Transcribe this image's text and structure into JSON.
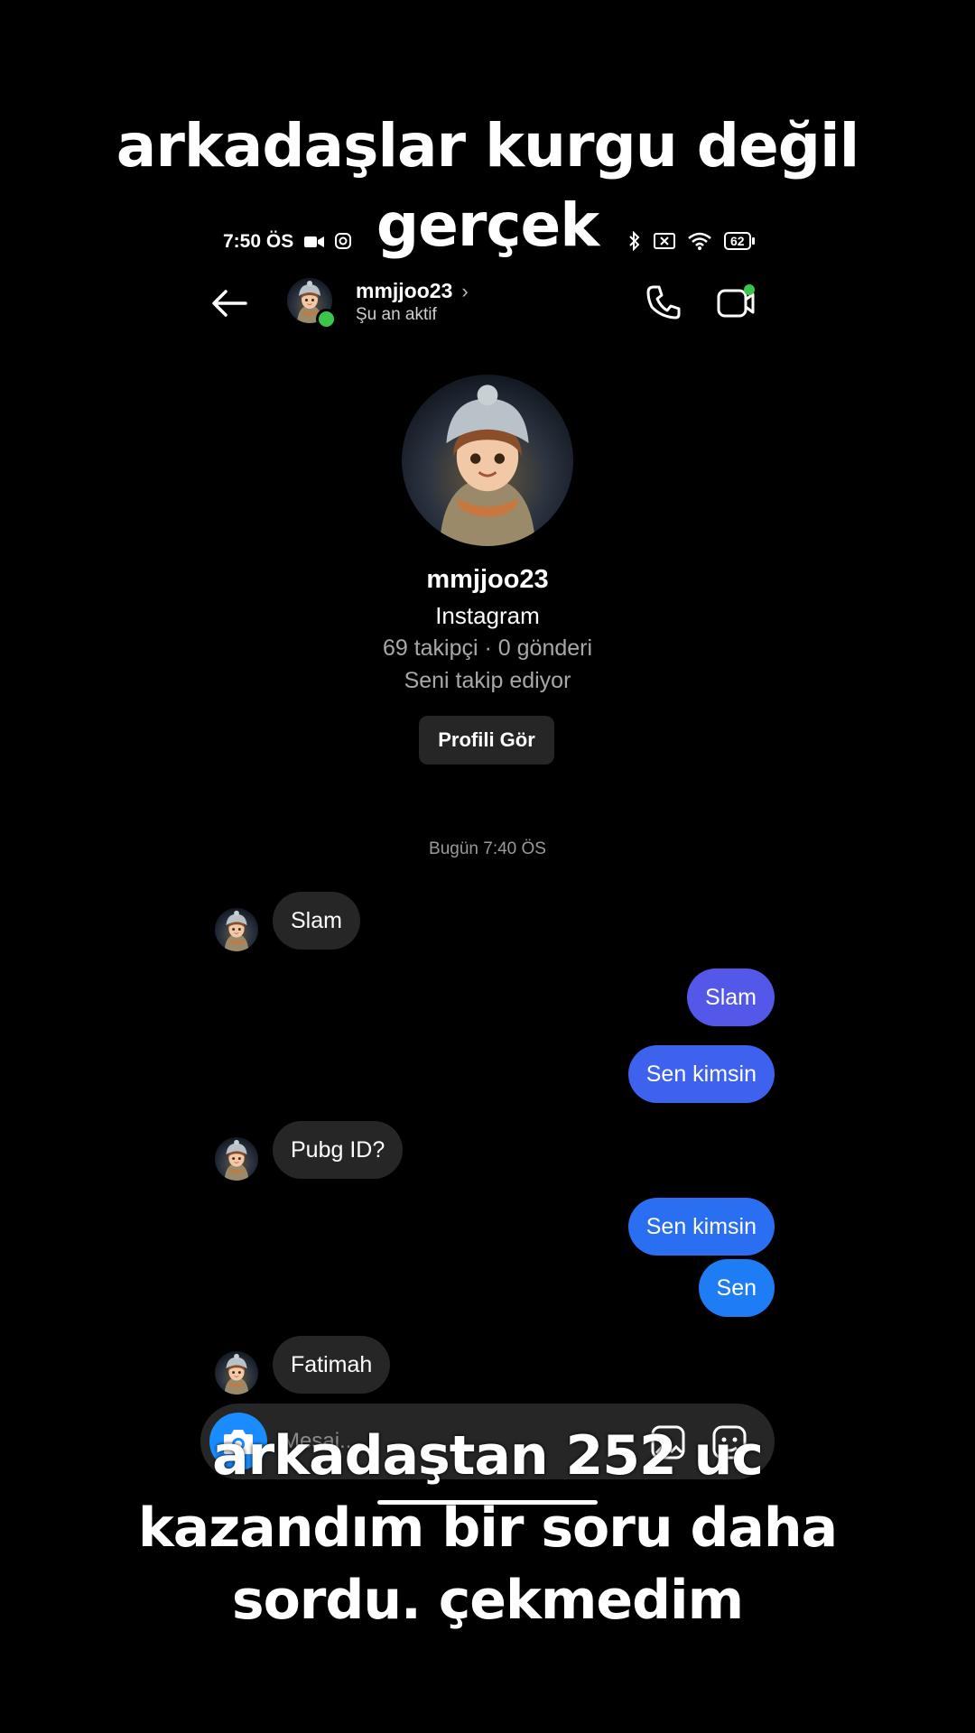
{
  "overlay": {
    "top_caption_line1": "arkadaşlar kurgu değil",
    "top_caption_line2": "gerçek",
    "bottom_caption_line1": "arkadaştan 252 uc",
    "bottom_caption_line2": "kazandım bir soru daha",
    "bottom_caption_line3": "sordu. çekmedim"
  },
  "status_bar": {
    "time": "7:50 ÖS",
    "battery": "62"
  },
  "header": {
    "username": "mmjjoo23",
    "chevron": "›",
    "status": "Şu an aktif"
  },
  "profile": {
    "username": "mmjjoo23",
    "platform": "Instagram",
    "stats": "69 takipçi · 0 gönderi",
    "follow_status": "Seni takip ediyor",
    "view_profile_label": "Profili Gör"
  },
  "thread": {
    "timestamp": "Bugün 7:40 ÖS",
    "messages": [
      {
        "from": "them",
        "text": "Slam"
      },
      {
        "from": "me",
        "text": "Slam"
      },
      {
        "from": "me",
        "text": "Sen kimsin"
      },
      {
        "from": "them",
        "text": "Pubg ID?"
      },
      {
        "from": "me",
        "text": "Sen kimsin"
      },
      {
        "from": "me",
        "text": "Sen"
      },
      {
        "from": "them",
        "text": "Fatimah"
      }
    ]
  },
  "composer": {
    "placeholder": "Mesaj..."
  },
  "colors": {
    "outgoing_bubble_1": "#5458e8",
    "outgoing_bubble_2": "#3f62ee",
    "outgoing_bubble_3": "#2a6ff2",
    "outgoing_bubble_4": "#1e7cf5",
    "incoming_bubble": "#262626",
    "online": "#3bc54a",
    "camera_button": "#1a8cff"
  },
  "icons": [
    "back-arrow-icon",
    "chevron-right-icon",
    "phone-icon",
    "video-call-icon",
    "camera-icon",
    "gallery-icon",
    "sticker-icon",
    "bluetooth-icon",
    "wifi-icon",
    "battery-icon",
    "video-record-icon",
    "instagram-icon"
  ]
}
